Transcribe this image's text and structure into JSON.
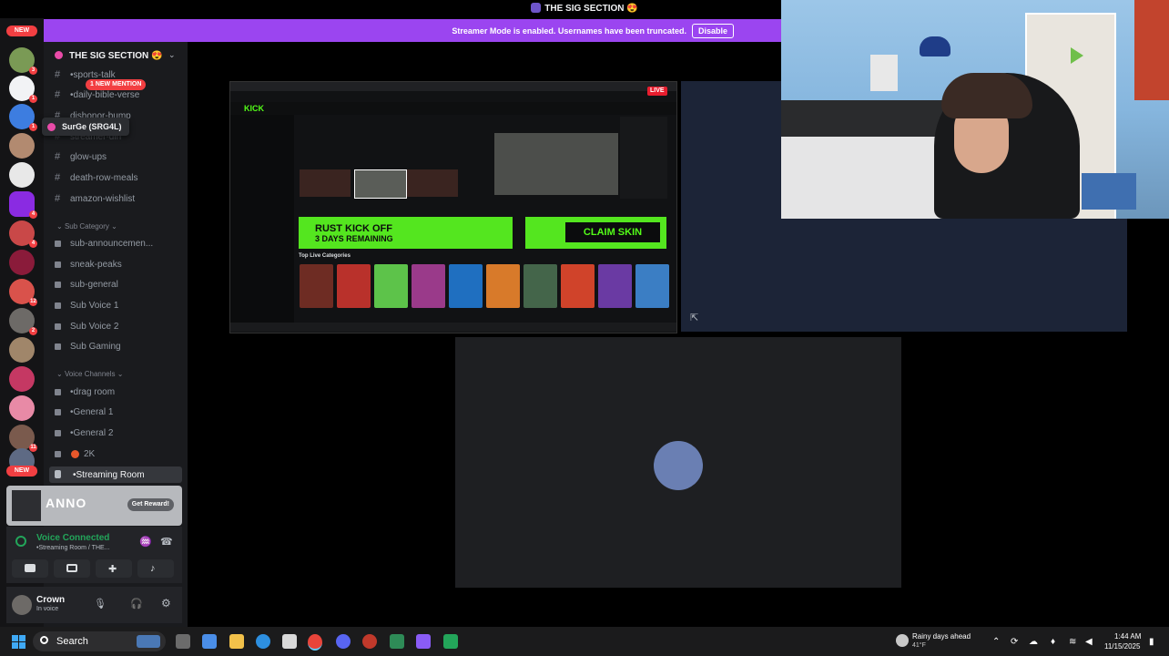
{
  "window": {
    "title": "THE SIG SECTION 😍"
  },
  "banner": {
    "text": "Streamer Mode is enabled. Usernames have been truncated.",
    "disable_label": "Disable"
  },
  "rail": {
    "new_label": "NEW",
    "badges": [
      "3",
      "1",
      "1",
      "4",
      "4",
      "4",
      "12",
      "2",
      "11",
      "11"
    ],
    "bottom_new_label": "NEW"
  },
  "sidebar": {
    "server_name": "THE SIG SECTION 😍",
    "mention_label": "1 NEW MENTION",
    "tooltip": "SurGe (SRG4L)",
    "channels_top": [
      "•sports-talk",
      "•daily-bible-verse",
      "dishonor-bump",
      "streamer-din"
    ],
    "channels": [
      "glow-ups",
      "death-row-meals",
      "amazon-wishlist"
    ],
    "sub_category": "Sub Category",
    "sub_channels": [
      "sub-announcemen...",
      "sneak-peaks",
      "sub-general",
      "Sub Voice 1",
      "Sub Voice 2",
      "Sub Gaming"
    ],
    "voice_category": "Voice Channels",
    "voice_channels": [
      "•drag room",
      "•General 1",
      "•General 2",
      "2K",
      "•Streaming Room"
    ]
  },
  "ad": {
    "brand": "ANNO",
    "button": "Get Reward!"
  },
  "voice_panel": {
    "status": "Voice Connected",
    "channel": "•Streaming Room / THE..."
  },
  "user": {
    "name": "Crown",
    "status": "In voice"
  },
  "shared_screen": {
    "live_label": "LIVE",
    "logo": "KICK",
    "promo_line1": "RUST KICK OFF",
    "promo_line2": "3 DAYS REMAINING",
    "claim_label": "CLAIM SKIN",
    "categories_title": "Top Live Categories"
  },
  "taskbar": {
    "search_label": "Search",
    "weather_title": "Rainy days ahead",
    "weather_temp": "41°F",
    "time": "1:44 AM",
    "date": "11/15/2025"
  },
  "colors": {
    "accent": "#9b45f0",
    "voice_green": "#23a55a",
    "kick_green": "#53fc18"
  }
}
